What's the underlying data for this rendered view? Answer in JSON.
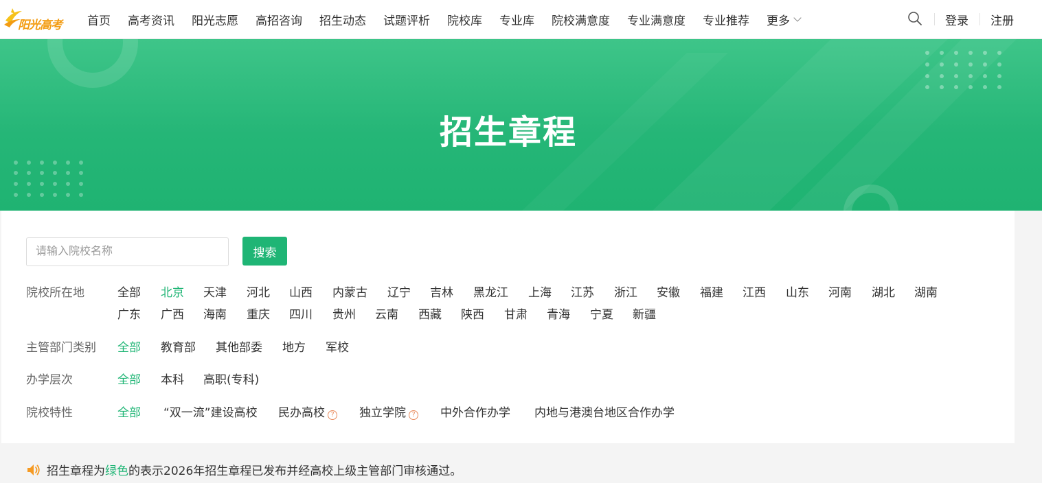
{
  "logo": {
    "text": "阳光高考"
  },
  "nav": {
    "items": [
      "首页",
      "高考资讯",
      "阳光志愿",
      "高招咨询",
      "招生动态",
      "试题评析",
      "院校库",
      "专业库",
      "院校满意度",
      "专业满意度",
      "专业推荐"
    ],
    "more_label": "更多"
  },
  "auth": {
    "login": "登录",
    "register": "注册"
  },
  "banner": {
    "title": "招生章程"
  },
  "search": {
    "placeholder": "请输入院校名称",
    "value": "",
    "button": "搜索"
  },
  "filters": {
    "location": {
      "label": "院校所在地",
      "row1": [
        "全部",
        "北京",
        "天津",
        "河北",
        "山西",
        "内蒙古",
        "辽宁",
        "吉林",
        "黑龙江",
        "上海",
        "江苏",
        "浙江",
        "安徽",
        "福建",
        "江西",
        "山东",
        "河南",
        "湖北",
        "湖南"
      ],
      "row2": [
        "广东",
        "广西",
        "海南",
        "重庆",
        "四川",
        "贵州",
        "云南",
        "西藏",
        "陕西",
        "甘肃",
        "青海",
        "宁夏",
        "新疆"
      ],
      "selected": "北京"
    },
    "department": {
      "label": "主管部门类别",
      "options": [
        "全部",
        "教育部",
        "其他部委",
        "地方",
        "军校"
      ],
      "selected": "全部"
    },
    "level": {
      "label": "办学层次",
      "options": [
        "全部",
        "本科",
        "高职(专科)"
      ],
      "selected": "全部"
    },
    "feature": {
      "label": "院校特性",
      "options": [
        "全部",
        "“双一流”建设高校",
        "民办高校",
        "独立学院",
        "中外合作办学",
        "内地与港澳台地区合作办学"
      ],
      "selected": "全部"
    }
  },
  "notice": {
    "prefix": "招生章程为",
    "highlight": "绿色",
    "suffix": "的表示2026年招生章程已发布并经高校上级主管部门审核通过。"
  },
  "colors": {
    "primary": "#1fb575",
    "banner_top": "#3ec589",
    "banner_bottom": "#1fb372",
    "help_icon": "#e8895a"
  },
  "icons": {
    "search": "search-icon",
    "more": "chevron-down-icon",
    "help": "question-circle-icon",
    "notice": "speaker-icon"
  }
}
